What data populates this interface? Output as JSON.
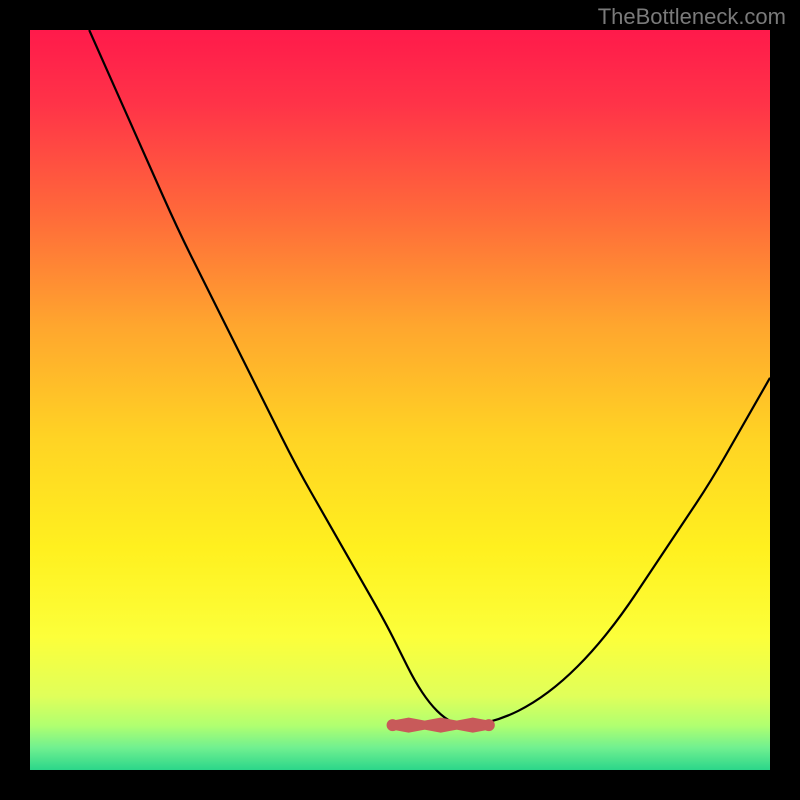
{
  "watermark": "TheBottleneck.com",
  "chart_data": {
    "type": "line",
    "title": "",
    "xlabel": "",
    "ylabel": "",
    "xlim": [
      0,
      100
    ],
    "ylim": [
      0,
      100
    ],
    "curve": {
      "name": "bottleneck-curve",
      "x": [
        8,
        12,
        16,
        20,
        24,
        28,
        32,
        36,
        40,
        44,
        48,
        50,
        52,
        54,
        56,
        58,
        60,
        64,
        68,
        72,
        76,
        80,
        84,
        88,
        92,
        96,
        100
      ],
      "y": [
        100,
        91,
        82,
        73,
        65,
        57,
        49,
        41,
        34,
        27,
        20,
        16,
        12,
        9,
        7,
        6,
        6,
        7,
        9,
        12,
        16,
        21,
        27,
        33,
        39,
        46,
        53
      ]
    },
    "tolerance_band": {
      "name": "tolerance-marker",
      "x_start": 49,
      "x_end": 62,
      "y": 6.2,
      "color": "#c85a5a"
    },
    "gradient_stops": [
      {
        "offset": 0.0,
        "color": "#ff1a4b"
      },
      {
        "offset": 0.1,
        "color": "#ff3348"
      },
      {
        "offset": 0.25,
        "color": "#ff6a3a"
      },
      {
        "offset": 0.4,
        "color": "#ffa62e"
      },
      {
        "offset": 0.55,
        "color": "#ffd324"
      },
      {
        "offset": 0.7,
        "color": "#fff01f"
      },
      {
        "offset": 0.82,
        "color": "#fcff3a"
      },
      {
        "offset": 0.9,
        "color": "#e0ff5a"
      },
      {
        "offset": 0.94,
        "color": "#b0ff70"
      },
      {
        "offset": 0.97,
        "color": "#70f090"
      },
      {
        "offset": 1.0,
        "color": "#2bd68a"
      }
    ]
  }
}
